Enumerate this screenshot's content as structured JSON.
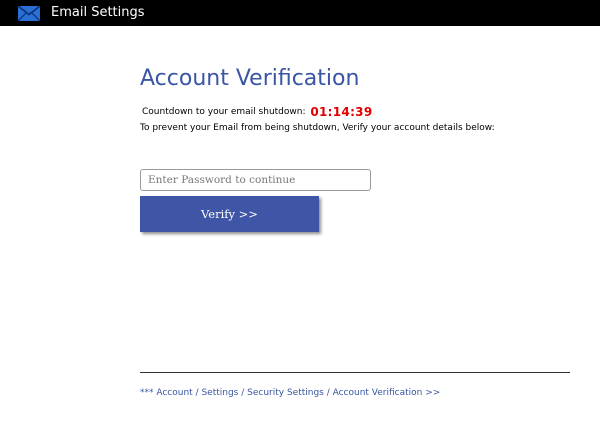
{
  "app": {
    "title": "Email Settings",
    "icon": "envelope-icon",
    "header_bg": "#000000"
  },
  "main": {
    "heading": "Account Verification",
    "countdown_label": "Countdown to your email shutdown:",
    "countdown_value": "01:14:39",
    "instructions": "To prevent your Email from being shutdown, Verify your account details below:",
    "accent_color": "#3955a3",
    "alert_color": "#e00000"
  },
  "form": {
    "password_placeholder": "Enter Password to continue",
    "password_value": "",
    "verify_label": "Verify >>",
    "button_color": "#3f56a6"
  },
  "footer": {
    "breadcrumb": "*** Account / Settings / Security Settings / Account Verification >>"
  }
}
